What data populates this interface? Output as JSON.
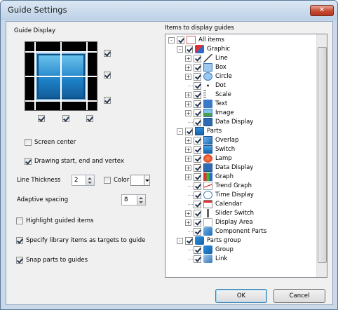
{
  "window": {
    "title": "Guide Settings",
    "close_label": "✕"
  },
  "guide_display": {
    "label": "Guide Display",
    "right_checks": [
      true,
      true,
      true
    ],
    "bottom_checks": [
      true,
      true,
      true
    ]
  },
  "options": {
    "screen_center": {
      "label": "Screen center",
      "checked": false
    },
    "drawing": {
      "label": "Drawing start, end and vertex",
      "checked": true
    },
    "line_thickness": {
      "label": "Line Thickness",
      "value": "2"
    },
    "color": {
      "label": "Color",
      "checked": false
    },
    "adaptive_spacing": {
      "label": "Adaptive spacing",
      "value": "8"
    },
    "highlight": {
      "label": "Highlight guided items",
      "checked": false
    },
    "specify_library": {
      "label": "Specify library items as targets to guide",
      "checked": true
    },
    "snap_parts": {
      "label": "Snap parts to guides",
      "checked": true
    }
  },
  "tree": {
    "label": "Items to display guides",
    "items": [
      {
        "label": "All items",
        "icon": "tag-icon",
        "level": 0,
        "expander": "-"
      },
      {
        "label": "Graphic",
        "icon": "shapes-icon",
        "level": 1,
        "expander": "-"
      },
      {
        "label": "Line",
        "icon": "line-icon",
        "level": 2,
        "expander": "+"
      },
      {
        "label": "Box",
        "icon": "box-icon",
        "level": 2,
        "expander": "+"
      },
      {
        "label": "Circle",
        "icon": "circle-icon",
        "level": 2,
        "expander": "+"
      },
      {
        "label": "Dot",
        "icon": "dot-icon",
        "level": 2,
        "expander": ""
      },
      {
        "label": "Scale",
        "icon": "scale-icon",
        "level": 2,
        "expander": "+"
      },
      {
        "label": "Text",
        "icon": "text-icon",
        "level": 2,
        "expander": "+"
      },
      {
        "label": "Image",
        "icon": "image-icon",
        "level": 2,
        "expander": "+"
      },
      {
        "label": "Data Display",
        "icon": "data-display-icon",
        "level": 2,
        "expander": ""
      },
      {
        "label": "Parts",
        "icon": "parts-icon",
        "level": 1,
        "expander": "-"
      },
      {
        "label": "Overlap",
        "icon": "overlap-icon",
        "level": 2,
        "expander": "+"
      },
      {
        "label": "Switch",
        "icon": "switch-icon",
        "level": 2,
        "expander": "+"
      },
      {
        "label": "Lamp",
        "icon": "lamp-icon",
        "level": 2,
        "expander": "+"
      },
      {
        "label": "Data Display",
        "icon": "data-display-icon",
        "level": 2,
        "expander": "+"
      },
      {
        "label": "Graph",
        "icon": "graph-icon",
        "level": 2,
        "expander": "+"
      },
      {
        "label": "Trend Graph",
        "icon": "trend-graph-icon",
        "level": 2,
        "expander": ""
      },
      {
        "label": "Time Display",
        "icon": "clock-icon",
        "level": 2,
        "expander": ""
      },
      {
        "label": "Calendar",
        "icon": "calendar-icon",
        "level": 2,
        "expander": ""
      },
      {
        "label": "Slider Switch",
        "icon": "slider-icon",
        "level": 2,
        "expander": "+"
      },
      {
        "label": "Display Area",
        "icon": "display-area-icon",
        "level": 2,
        "expander": "+"
      },
      {
        "label": "Component Parts",
        "icon": "component-icon",
        "level": 2,
        "expander": ""
      },
      {
        "label": "Parts group",
        "icon": "parts-group-icon",
        "level": 1,
        "expander": "-"
      },
      {
        "label": "Group",
        "icon": "group-icon",
        "level": 2,
        "expander": ""
      },
      {
        "label": "Link",
        "icon": "link-icon",
        "level": 2,
        "expander": ""
      }
    ]
  },
  "buttons": {
    "ok": "OK",
    "cancel": "Cancel"
  }
}
